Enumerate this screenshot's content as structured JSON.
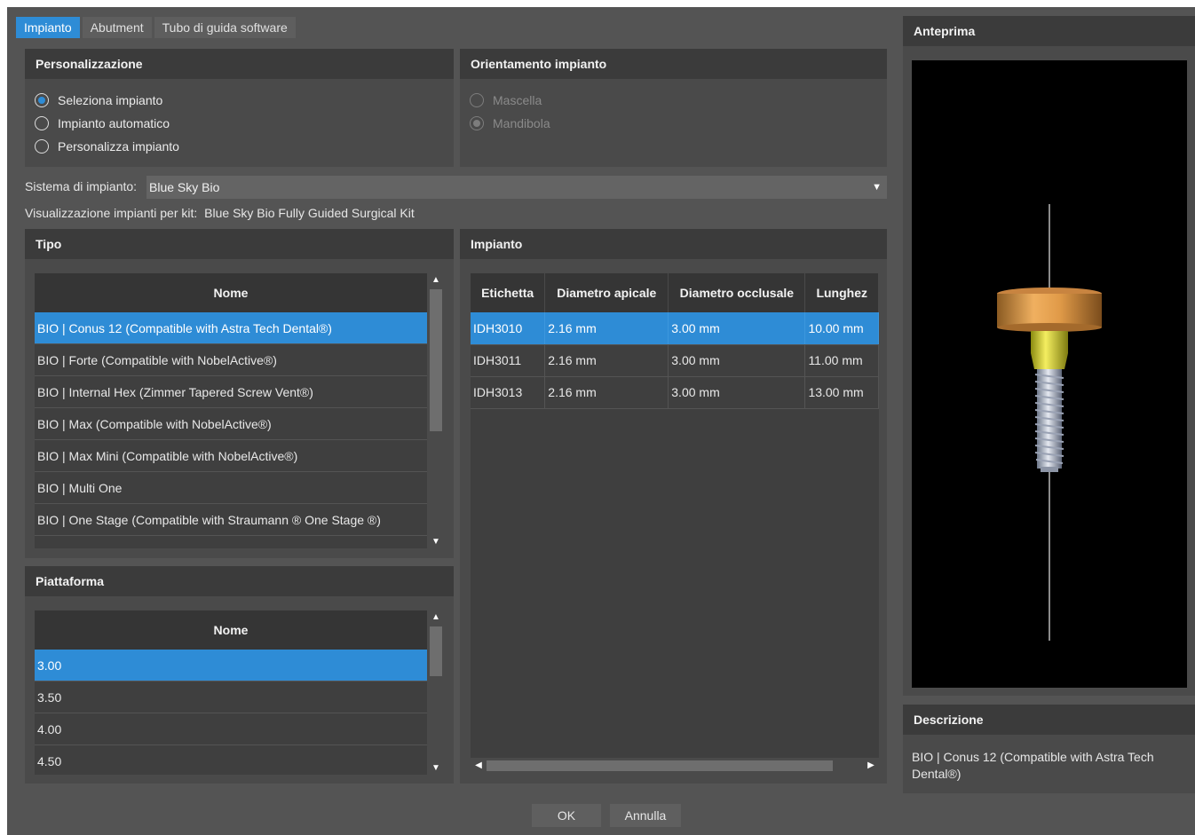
{
  "tabs": [
    "Impianto",
    "Abutment",
    "Tubo di guida software"
  ],
  "personalizzazione": {
    "title": "Personalizzazione",
    "options": [
      "Seleziona impianto",
      "Impianto automatico",
      "Personalizza impianto"
    ],
    "selected_index": 0
  },
  "orientamento": {
    "title": "Orientamento impianto",
    "options": [
      "Mascella",
      "Mandibola"
    ],
    "selected_index": 1,
    "disabled": true
  },
  "sistema": {
    "label": "Sistema di impianto:",
    "value": "Blue Sky Bio",
    "dropdown_icon": "triangle-down-icon"
  },
  "kit": {
    "label": "Visualizzazione impianti per kit:",
    "value": "Blue Sky Bio Fully Guided Surgical Kit"
  },
  "tipo": {
    "title": "Tipo",
    "column": "Nome",
    "items": [
      "BIO | Conus 12 (Compatible with Astra Tech Dental®)",
      "BIO | Forte (Compatible with NobelActive®)",
      "BIO | Internal Hex (Zimmer Tapered Screw Vent®)",
      "BIO | Max (Compatible with NobelActive®)",
      "BIO | Max Mini (Compatible with NobelActive®)",
      "BIO | Multi One",
      "BIO | One Stage (Compatible with Straumann ® One Stage ®)"
    ],
    "selected_index": 0
  },
  "piattaforma": {
    "title": "Piattaforma",
    "column": "Nome",
    "items": [
      "3.00",
      "3.50",
      "4.00",
      "4.50"
    ],
    "selected_index": 0
  },
  "impianto": {
    "title": "Impianto",
    "columns": [
      "Etichetta",
      "Diametro apicale",
      "Diametro occlusale",
      "Lunghez"
    ],
    "rows": [
      [
        "IDH3010",
        "2.16 mm",
        "3.00 mm",
        "10.00 mm"
      ],
      [
        "IDH3011",
        "2.16 mm",
        "3.00 mm",
        "11.00 mm"
      ],
      [
        "IDH3013",
        "2.16 mm",
        "3.00 mm",
        "13.00 mm"
      ]
    ],
    "selected_index": 0
  },
  "anteprima": {
    "title": "Anteprima"
  },
  "descrizione": {
    "title": "Descrizione",
    "text": "BIO | Conus 12 (Compatible with Astra Tech Dental®)"
  },
  "buttons": {
    "ok": "OK",
    "cancel": "Annulla"
  },
  "colors": {
    "accent": "#2e8cd6",
    "abutment": "#e0a050",
    "implant_yellow": "#e8e040"
  }
}
